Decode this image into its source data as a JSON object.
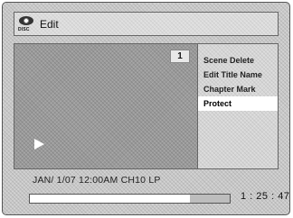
{
  "header": {
    "icon_label": "DISC",
    "title": "Edit"
  },
  "preview": {
    "title_number": "1"
  },
  "menu": {
    "items": [
      {
        "label": "Scene Delete",
        "selected": false
      },
      {
        "label": "Edit Title Name",
        "selected": false
      },
      {
        "label": "Chapter Mark",
        "selected": false
      },
      {
        "label": "Protect",
        "selected": true
      }
    ]
  },
  "status": {
    "info": "JAN/ 1/07 12:00AM CH10   LP",
    "progress_fraction": 0.8,
    "time": "1 : 25 : 47"
  },
  "colors": {
    "selected_bg": "#ffffff",
    "screen_bg": "#c9c9c9"
  }
}
